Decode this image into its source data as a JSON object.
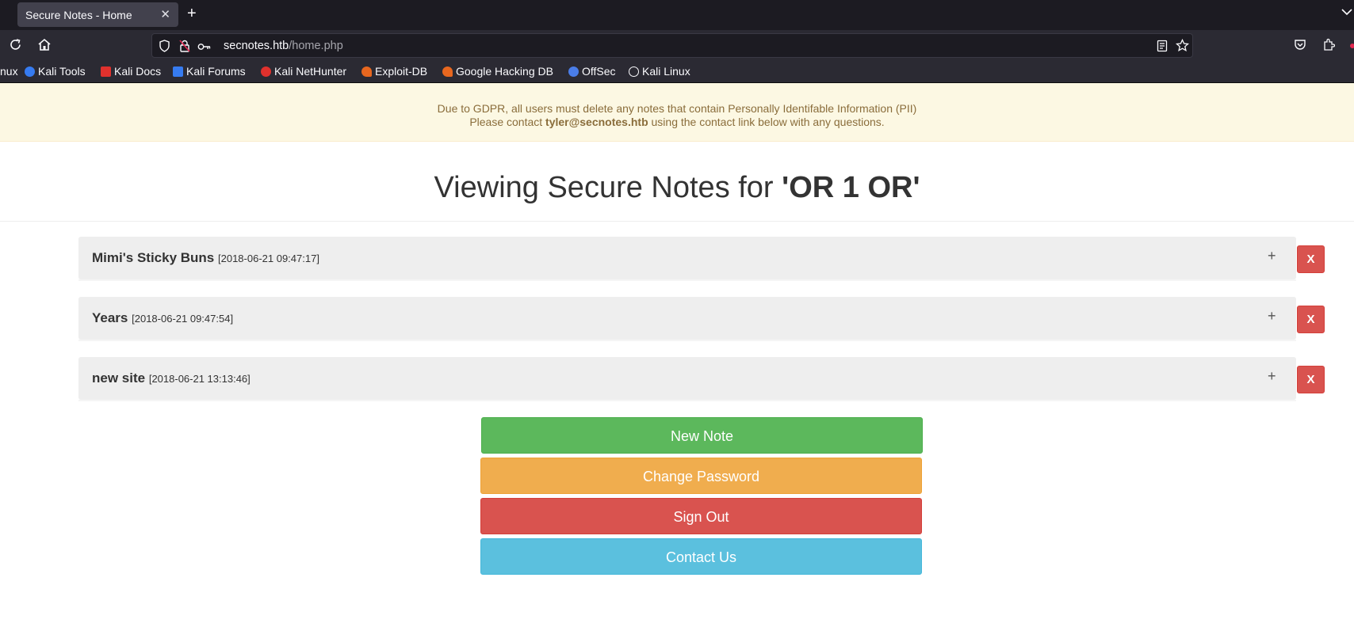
{
  "browser": {
    "tab_title": "Secure Notes - Home",
    "tab_close": "✕",
    "new_tab": "+",
    "url_host": "secnotes.htb",
    "url_path": "/home.php"
  },
  "bookmarks": [
    {
      "label": "nux",
      "color": "#2b2a33"
    },
    {
      "label": "Kali Tools",
      "color": "#367bf0"
    },
    {
      "label": "Kali Docs",
      "color": "#e0312d"
    },
    {
      "label": "Kali Forums",
      "color": "#367bf0"
    },
    {
      "label": "Kali NetHunter",
      "color": "#e0312d"
    },
    {
      "label": "Exploit-DB",
      "color": "#e8671f"
    },
    {
      "label": "Google Hacking DB",
      "color": "#e8671f"
    },
    {
      "label": "OffSec",
      "color": "#4a7de8"
    },
    {
      "label": "Kali Linux",
      "color": "#2b2a33"
    }
  ],
  "gdpr": {
    "line1": "Due to GDPR, all users must delete any notes that contain Personally Identifable Information (PII)",
    "line2_prefix": "Please contact ",
    "email": "tyler@secnotes.htb",
    "line2_suffix": " using the contact link below with any questions."
  },
  "heading": {
    "prefix": "Viewing Secure Notes for ",
    "username": "'OR 1 OR'"
  },
  "notes": [
    {
      "title": "Mimi's Sticky Buns",
      "date": "[2018-06-21 09:47:17]"
    },
    {
      "title": "Years",
      "date": "[2018-06-21 09:47:54]"
    },
    {
      "title": "new site",
      "date": "[2018-06-21 13:13:46]"
    }
  ],
  "note_expand_symbol": "+",
  "note_delete_label": "X",
  "actions": {
    "new_note": "New Note",
    "change_password": "Change Password",
    "sign_out": "Sign Out",
    "contact_us": "Contact Us"
  },
  "colors": {
    "gdpr_bg": "#fcf8e3",
    "gdpr_text": "#8a6d3b",
    "success": "#5cb85c",
    "warning": "#f0ad4e",
    "danger": "#d9534f",
    "info": "#5bc0de"
  }
}
